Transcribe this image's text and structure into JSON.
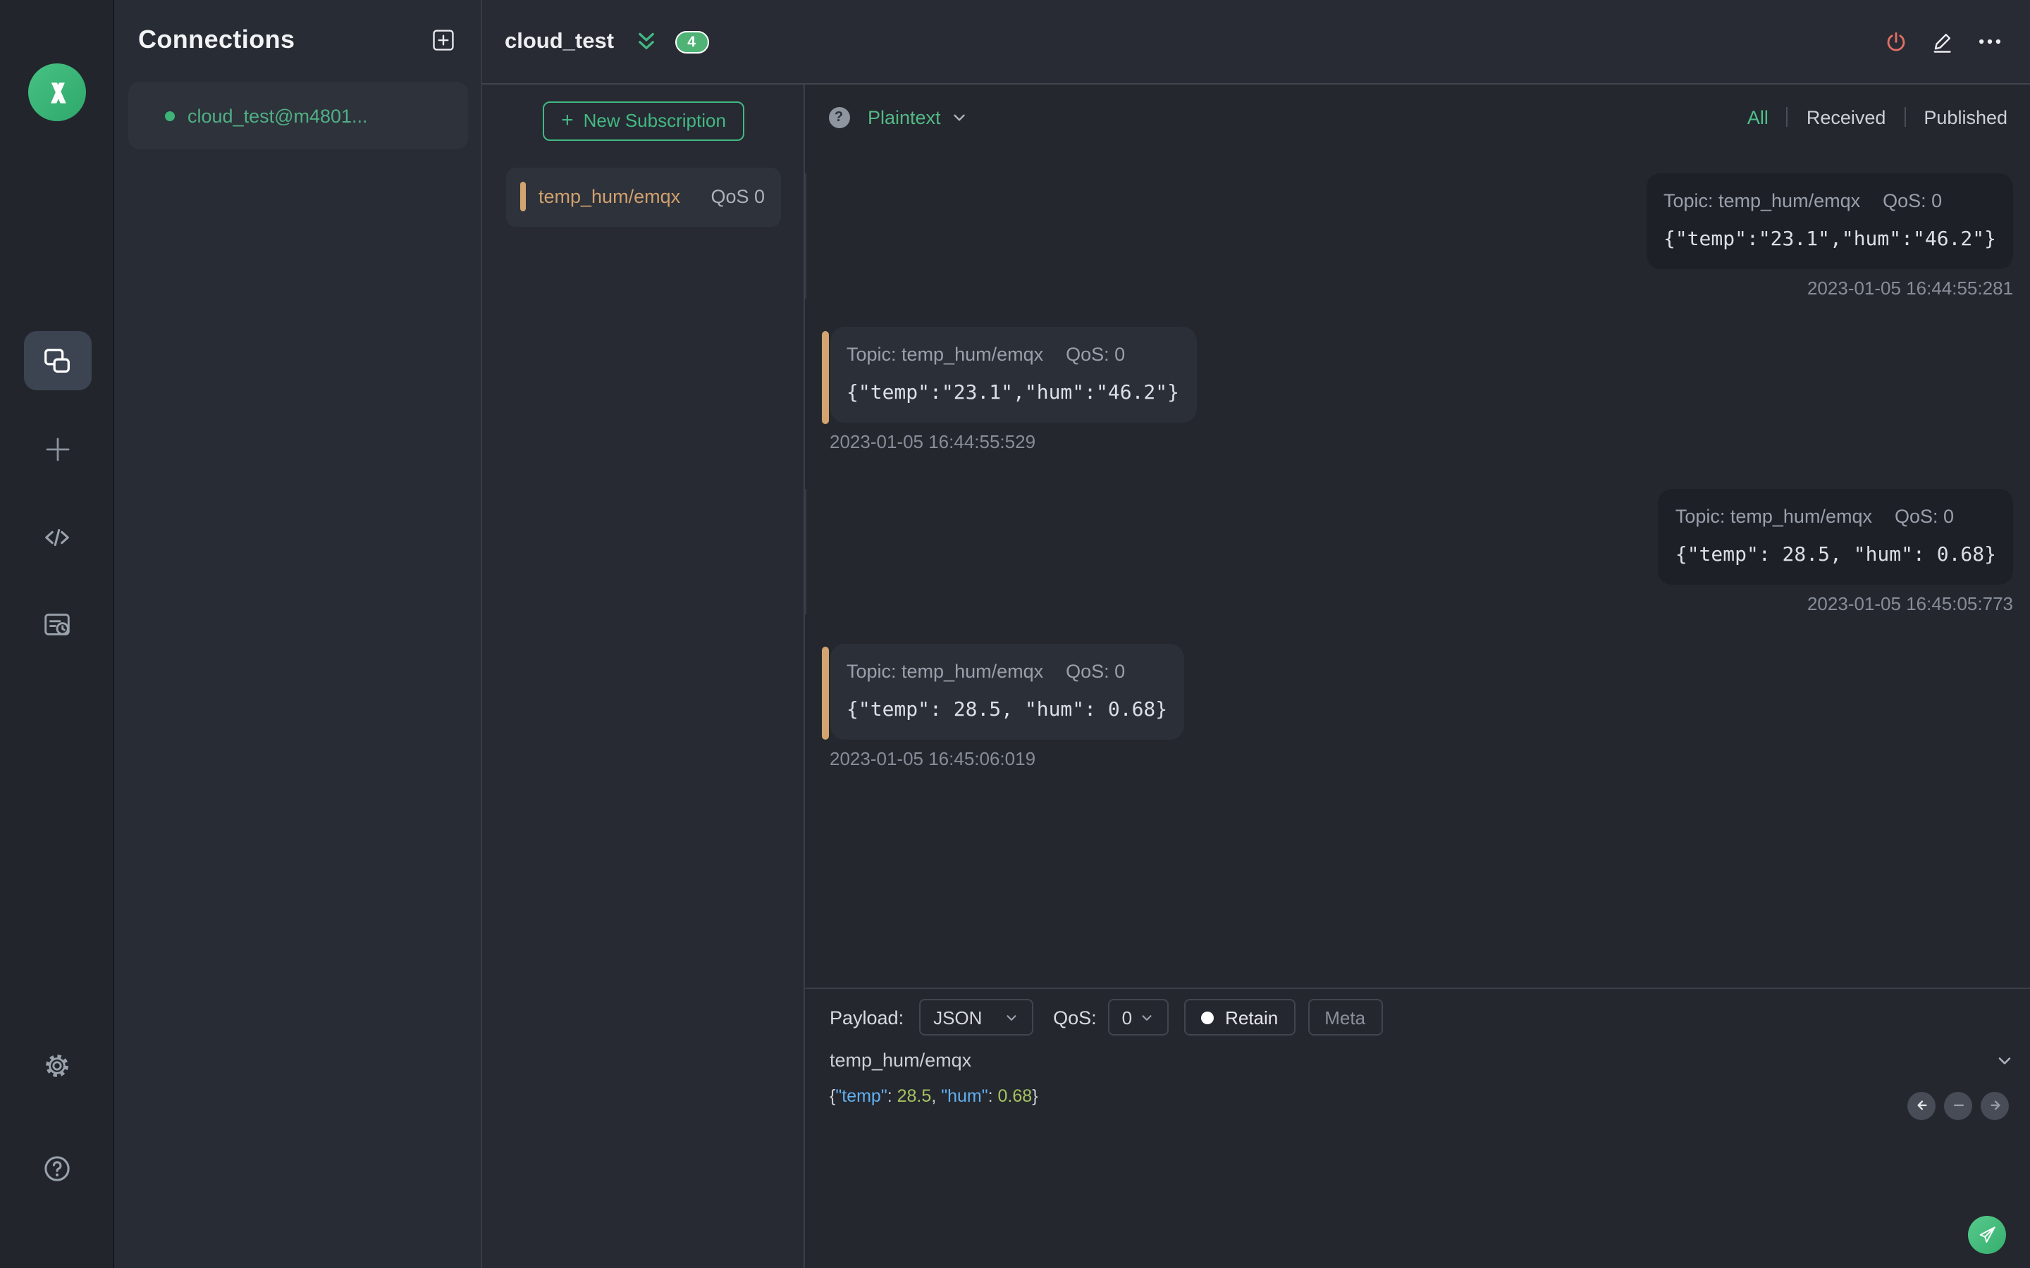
{
  "colors": {
    "accent_green": "#42b983",
    "tan_accent": "#d2a470",
    "power_red": "#e17066",
    "badge_green": "#4fb376",
    "syntax_key_blue": "#61afef",
    "syntax_number_green": "#a5c261",
    "panel_bg": "#282c34",
    "main_bg": "#24272e"
  },
  "rail": {
    "items": [
      {
        "name": "connections",
        "active": true
      },
      {
        "name": "new-connection",
        "active": false
      },
      {
        "name": "script",
        "active": false
      },
      {
        "name": "log",
        "active": false
      },
      {
        "name": "settings",
        "active": false
      },
      {
        "name": "help",
        "active": false
      }
    ]
  },
  "connections_panel": {
    "title": "Connections",
    "items": [
      {
        "name": "cloud_test@m4801...",
        "online": true
      }
    ]
  },
  "titlebar": {
    "title": "cloud_test",
    "message_count": "4"
  },
  "subscriptions": {
    "new_button_label": "New Subscription",
    "new_button_plus": "+",
    "items": [
      {
        "topic": "temp_hum/emqx",
        "qos": "QoS 0"
      }
    ]
  },
  "filterbar": {
    "help_glyph": "?",
    "format": "Plaintext",
    "tabs": [
      {
        "label": "All",
        "active": true
      },
      {
        "label": "Received",
        "active": false
      },
      {
        "label": "Published",
        "active": false
      }
    ]
  },
  "messages": [
    {
      "side": "right",
      "topic_label": "Topic: temp_hum/emqx",
      "qos_label": "QoS: 0",
      "payload": "{\"temp\":\"23.1\",\"hum\":\"46.2\"}",
      "timestamp": "2023-01-05 16:44:55:281"
    },
    {
      "side": "left",
      "topic_label": "Topic: temp_hum/emqx",
      "qos_label": "QoS: 0",
      "payload": "{\"temp\":\"23.1\",\"hum\":\"46.2\"}",
      "timestamp": "2023-01-05 16:44:55:529"
    },
    {
      "side": "right",
      "topic_label": "Topic: temp_hum/emqx",
      "qos_label": "QoS: 0",
      "payload": "{\"temp\": 28.5, \"hum\": 0.68}",
      "timestamp": "2023-01-05 16:45:05:773"
    },
    {
      "side": "left",
      "topic_label": "Topic: temp_hum/emqx",
      "qos_label": "QoS: 0",
      "payload": "{\"temp\": 28.5, \"hum\": 0.68}",
      "timestamp": "2023-01-05 16:45:06:019"
    }
  ],
  "publish": {
    "payload_label": "Payload:",
    "format_value": "JSON",
    "qos_label": "QoS:",
    "qos_value": "0",
    "retain_label": "Retain",
    "meta_label": "Meta",
    "topic_value": "temp_hum/emqx",
    "payload_tokens": [
      {
        "text": "{"
      },
      {
        "text": "\"temp\""
      },
      {
        "text": ": "
      },
      {
        "text": "28.5"
      },
      {
        "text": ", "
      },
      {
        "text": "\"hum\""
      },
      {
        "text": ": "
      },
      {
        "text": "0.68"
      },
      {
        "text": "}"
      }
    ]
  }
}
